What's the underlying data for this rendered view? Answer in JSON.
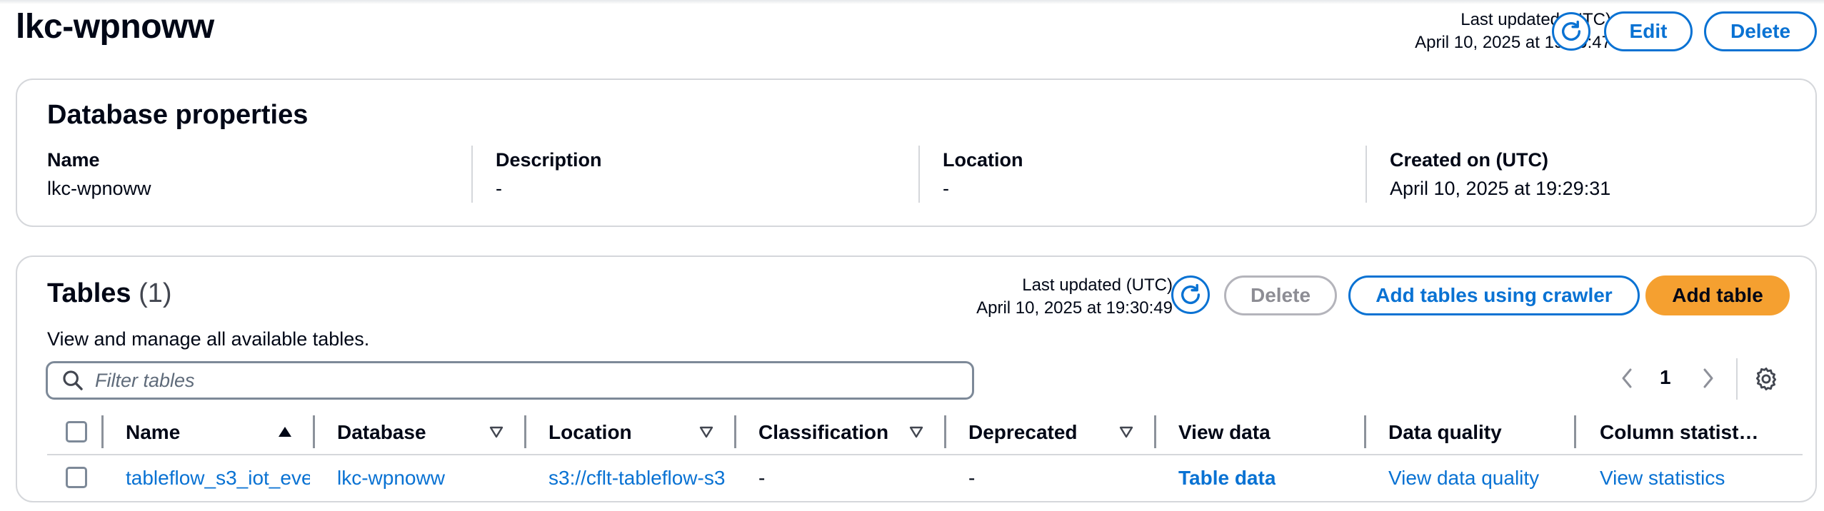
{
  "page": {
    "title": "lkc-wpnoww"
  },
  "header": {
    "last_updated_label": "Last updated (UTC)",
    "last_updated_value": "April 10, 2025 at 19:30:47",
    "edit_label": "Edit",
    "delete_label": "Delete"
  },
  "properties": {
    "title": "Database properties",
    "fields": [
      {
        "key": "Name",
        "value": "lkc-wpnoww"
      },
      {
        "key": "Description",
        "value": "-"
      },
      {
        "key": "Location",
        "value": "-"
      },
      {
        "key": "Created on (UTC)",
        "value": "April 10, 2025 at 19:29:31"
      }
    ]
  },
  "tables": {
    "title": "Tables",
    "count": "(1)",
    "description": "View and manage all available tables.",
    "last_updated_label": "Last updated (UTC)",
    "last_updated_value": "April 10, 2025 at 19:30:49",
    "delete_label": "Delete",
    "add_crawler_label": "Add tables using crawler",
    "add_table_label": "Add table",
    "filter_placeholder": "Filter tables",
    "page_number": "1",
    "columns": [
      "Name",
      "Database",
      "Location",
      "Classification",
      "Deprecated",
      "View data",
      "Data quality",
      "Column statist…"
    ],
    "rows": [
      {
        "name": "tableflow_s3_iot_eve",
        "database": "lkc-wpnoww",
        "location": "s3://cflt-tableflow-s3",
        "classification": "-",
        "deprecated": "-",
        "view_data": "Table data",
        "data_quality": "View data quality",
        "column_statistics": "View statistics"
      }
    ]
  },
  "colors": {
    "accent": "#0972d3",
    "primary_button": "#f5a030",
    "text": "#000716",
    "border": "#d5d7db"
  },
  "icons": [
    "refresh-icon",
    "search-icon",
    "chevron-left-icon",
    "chevron-right-icon",
    "settings-gear-icon",
    "sort-ascending-icon",
    "sort-descending-icon"
  ]
}
